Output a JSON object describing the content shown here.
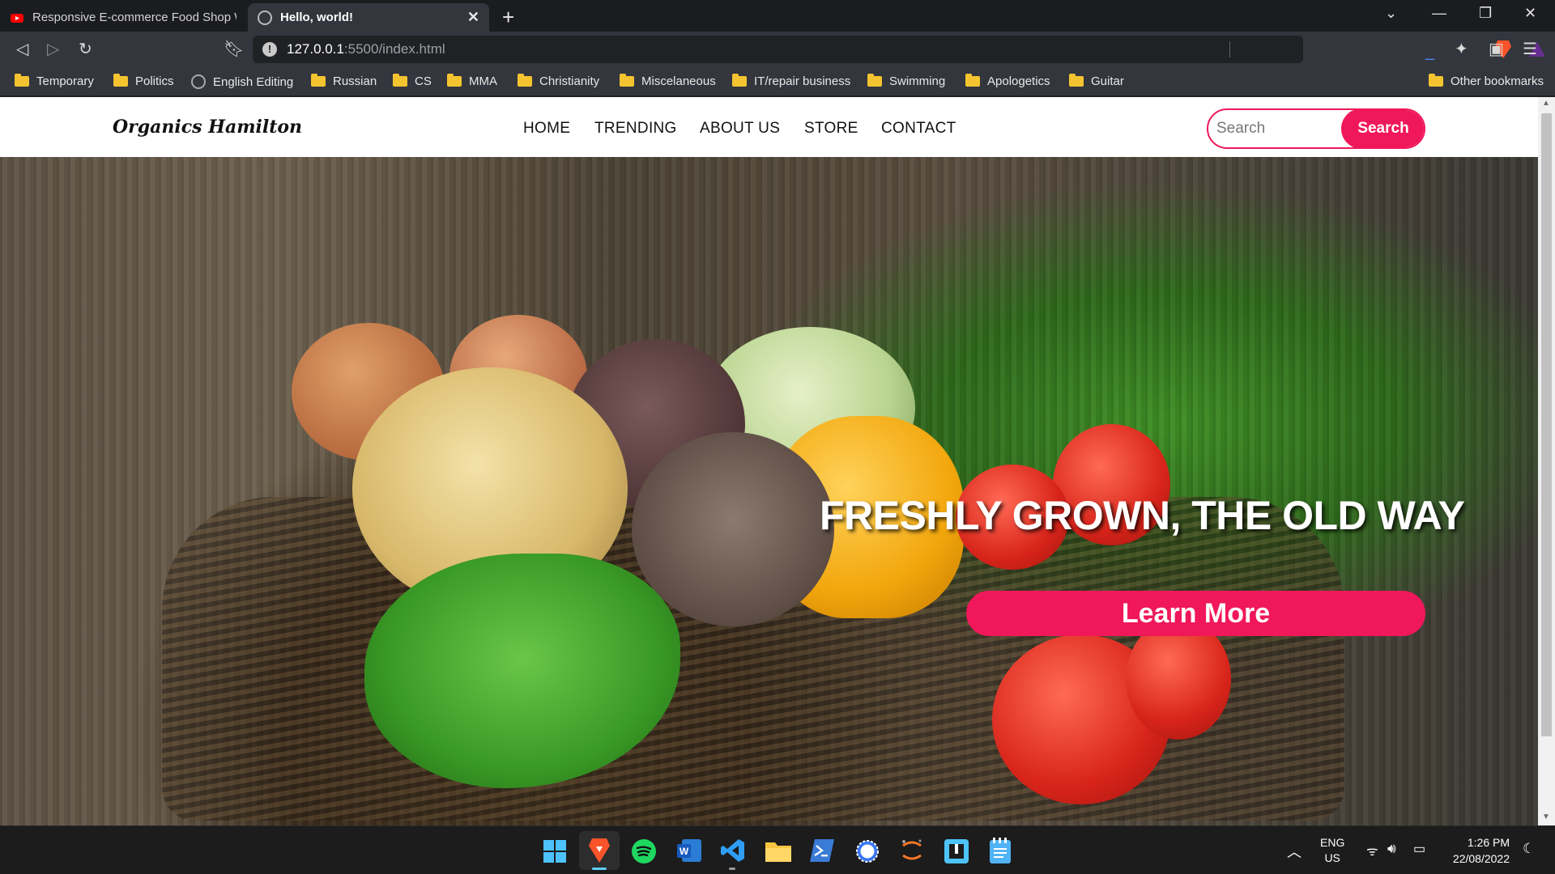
{
  "browser": {
    "tabs": [
      {
        "title": "Responsive E-commerce Food Shop W",
        "active": false
      },
      {
        "title": "Hello, world!",
        "active": true
      }
    ],
    "new_tab_icon": "plus-icon",
    "url_host": "127.0.0.1",
    "url_rest": ":5500/index.html"
  },
  "bookmarks": [
    {
      "label": "Temporary",
      "icon": "folder-icon"
    },
    {
      "label": "Politics",
      "icon": "folder-icon"
    },
    {
      "label": "English Editing",
      "icon": "globe-icon"
    },
    {
      "label": "Russian",
      "icon": "folder-icon"
    },
    {
      "label": "CS",
      "icon": "folder-icon"
    },
    {
      "label": "MMA",
      "icon": "folder-icon"
    },
    {
      "label": "Christianity",
      "icon": "folder-icon"
    },
    {
      "label": "Miscelaneous",
      "icon": "folder-icon"
    },
    {
      "label": "IT/repair business",
      "icon": "folder-icon"
    },
    {
      "label": "Swimming",
      "icon": "folder-icon"
    },
    {
      "label": "Apologetics",
      "icon": "folder-icon"
    },
    {
      "label": "Guitar",
      "icon": "folder-icon"
    },
    {
      "label": "Other bookmarks",
      "icon": "folder-icon"
    }
  ],
  "site": {
    "logo": "Organics Hamilton",
    "nav": [
      "HOME",
      "TRENDING",
      "ABOUT US",
      "STORE",
      "CONTACT"
    ],
    "search_placeholder": "Search",
    "search_button": "Search",
    "hero_title": "FRESHLY GROWN, THE OLD WAY",
    "hero_button": "Learn More",
    "accent_color": "#f0185a"
  },
  "system": {
    "lang": "ENG",
    "region": "US",
    "time": "1:26 PM",
    "date": "22/08/2022"
  }
}
